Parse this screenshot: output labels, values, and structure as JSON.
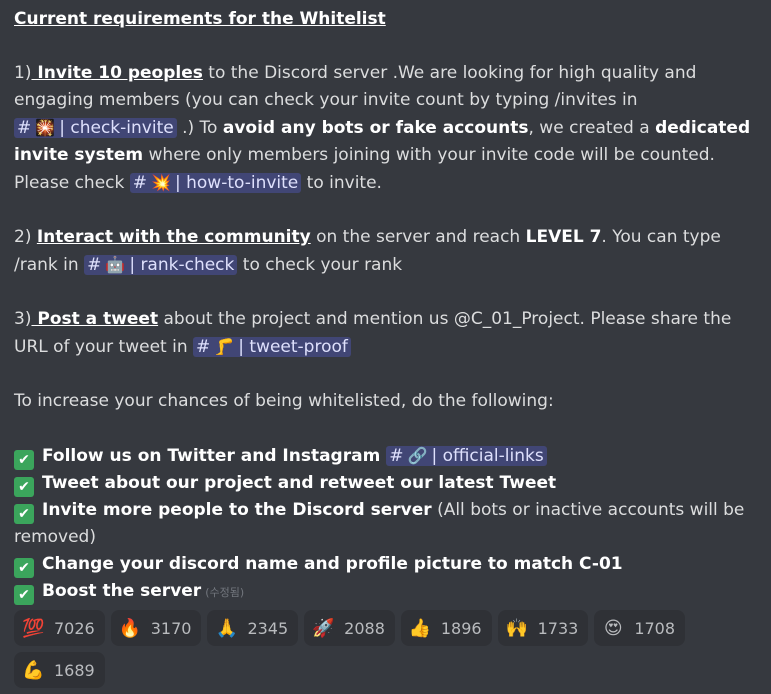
{
  "heading": "Current requirements for the Whitelist",
  "req1": {
    "prefix": "1)",
    "bold": " Invite 10 peoples",
    "text1": " to the Discord server .We are looking for high quality and engaging members (you can check your invite count by typing /invites in ",
    "mention1": {
      "icon": "🎇",
      "label": "| check-invite"
    },
    "text2": " .) To ",
    "bold2": "avoid any bots or fake accounts",
    "text3": ", we created a ",
    "bold3": "dedicated invite system",
    "text4": " where only members joining with your invite code will be counted. Please check ",
    "mention2": {
      "icon": "💥",
      "label": "| how-to-invite"
    },
    "text5": " to invite."
  },
  "req2": {
    "prefix": "2) ",
    "bold": "Interact with the community",
    "text1": " on the server and reach ",
    "bold2": "LEVEL 7",
    "text2": ". You can type /rank in ",
    "mention": {
      "icon": "🤖",
      "label": "| rank-check"
    },
    "text3": " to check your rank"
  },
  "req3": {
    "prefix": "3)",
    "bold": " Post a tweet",
    "text1": " about the project and mention us @C_01_Project. Please share the URL of your tweet in ",
    "mention": {
      "icon": "🦵",
      "label": "| tweet-proof"
    }
  },
  "increase_text": "To increase your chances of being whitelisted, do the following:",
  "bullets": [
    {
      "bold": "Follow us on Twitter and Instagram",
      "mention": {
        "icon": "🔗",
        "label": "| official-links"
      }
    },
    {
      "bold": "Tweet about our project and retweet our latest Tweet"
    },
    {
      "bold": "Invite more people to the Discord server",
      "tail": " (All bots or inactive accounts will be removed)"
    },
    {
      "bold": "Change your discord name and profile picture to match C-01"
    },
    {
      "bold": "Boost the server",
      "edited": "(수정됨)"
    }
  ],
  "check_glyph": "✔",
  "hash_glyph": "#",
  "reactions": [
    {
      "emoji": "💯",
      "count": "7026"
    },
    {
      "emoji": "🔥",
      "count": "3170"
    },
    {
      "emoji": "🙏",
      "count": "2345"
    },
    {
      "emoji": "🚀",
      "count": "2088"
    },
    {
      "emoji": "👍",
      "count": "1896"
    },
    {
      "emoji": "🙌",
      "count": "1733"
    },
    {
      "emoji": "😍",
      "count": "1708"
    },
    {
      "emoji": "💪",
      "count": "1689"
    }
  ],
  "colors": {
    "background": "#36393f",
    "mention_bg": "#414675",
    "mention_text": "#dee0fc",
    "check_green": "#3ba55c",
    "reaction_bg": "#2f3136"
  }
}
